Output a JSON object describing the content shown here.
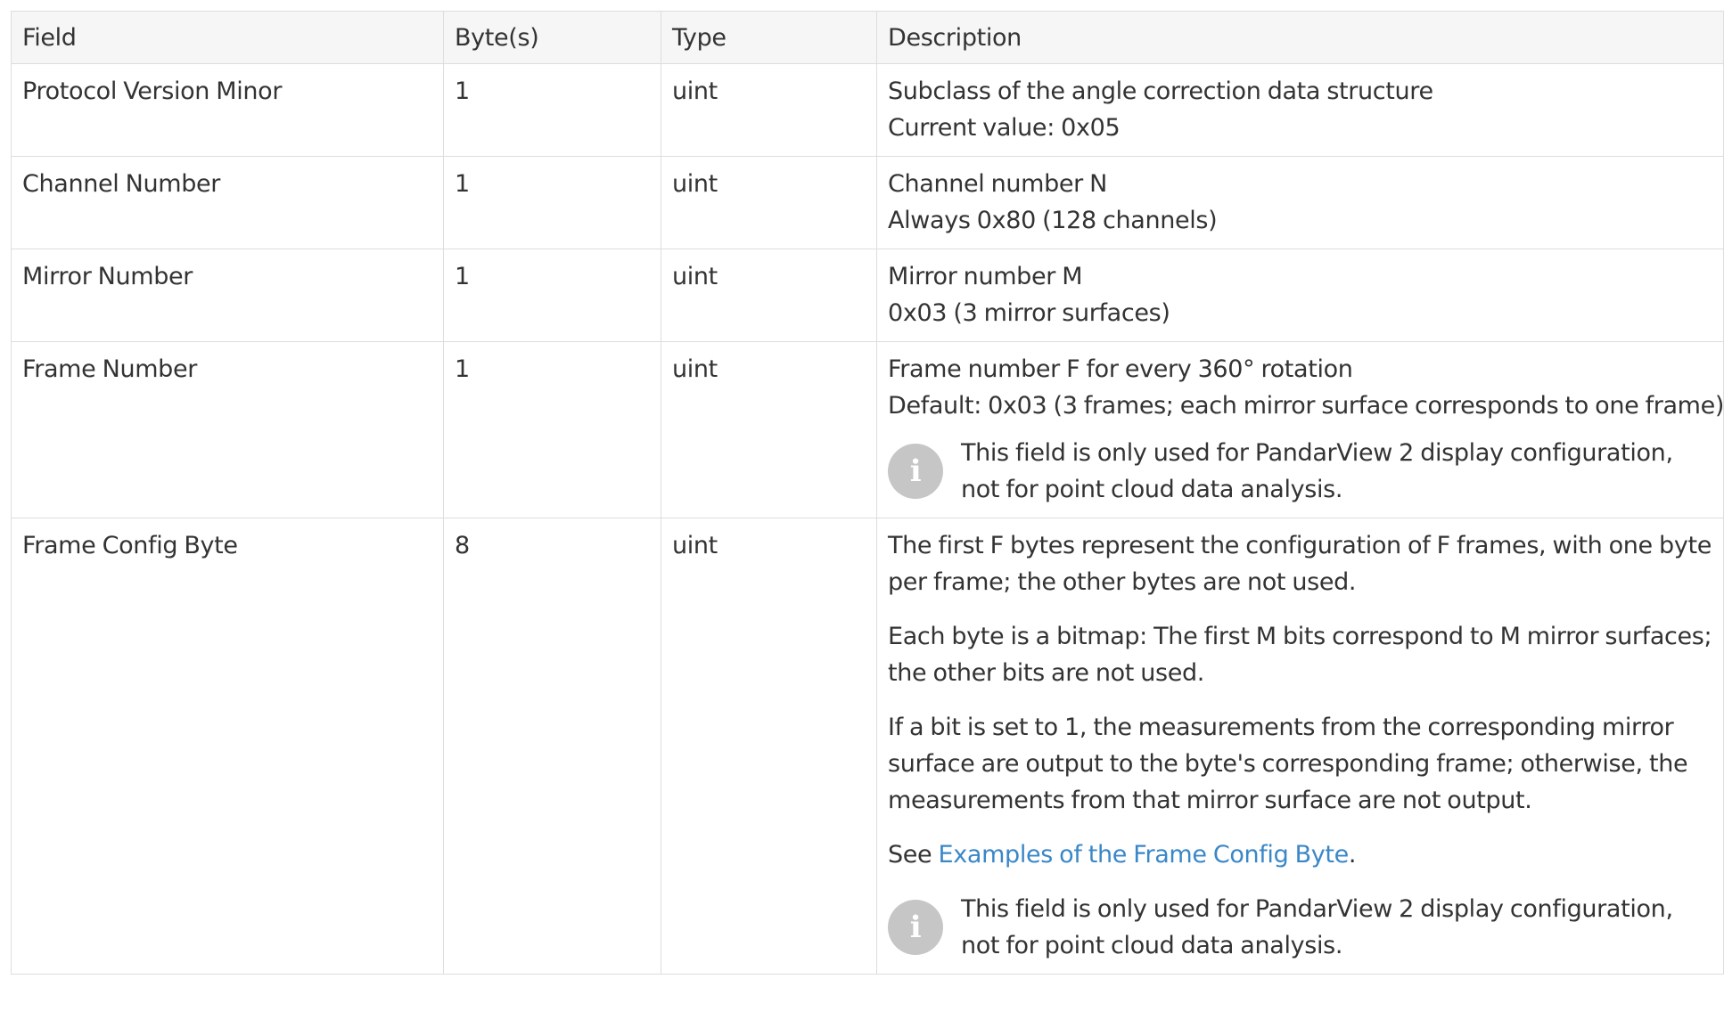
{
  "table": {
    "headers": [
      "Field",
      "Byte(s)",
      "Type",
      "Description"
    ],
    "rows": [
      {
        "field": "Protocol Version Minor",
        "bytes": "1",
        "type": "uint",
        "desc_lines": [
          "Subclass of the angle correction data structure",
          "Current value: 0x05"
        ]
      },
      {
        "field": "Channel Number",
        "bytes": "1",
        "type": "uint",
        "desc_lines": [
          "Channel number N",
          "Always 0x80 (128 channels)"
        ]
      },
      {
        "field": "Mirror Number",
        "bytes": "1",
        "type": "uint",
        "desc_lines": [
          "Mirror number M",
          "0x03 (3 mirror surfaces)"
        ]
      },
      {
        "field": "Frame Number",
        "bytes": "1",
        "type": "uint",
        "desc_lines": [
          "Frame number F for every 360° rotation",
          "Default: 0x03 (3 frames; each mirror surface corresponds to one frame)"
        ],
        "note": [
          "This field is only used for PandarView 2 display configuration,",
          "not for point cloud data analysis."
        ]
      },
      {
        "field": "Frame Config Byte",
        "bytes": "8",
        "type": "uint",
        "paragraphs": [
          [
            "The first F bytes represent the configuration of F frames, with one byte",
            "per frame; the other bytes are not used."
          ],
          [
            "Each byte is a bitmap: The first M bits correspond to M mirror surfaces;",
            "the other bits are not used."
          ],
          [
            "If a bit is set to 1, the measurements from the corresponding mirror",
            "surface are output to the byte's corresponding frame; otherwise, the",
            "measurements from that mirror surface are not output."
          ]
        ],
        "see": {
          "prefix": "See ",
          "link_text": "Examples of the Frame Config Byte",
          "suffix": "."
        },
        "note": [
          "This field is only used for PandarView 2 display configuration,",
          "not for point cloud data analysis."
        ]
      }
    ]
  },
  "icons": {
    "note": "info-icon"
  },
  "colors": {
    "link": "#3a87c8",
    "header_bg": "#f6f6f6",
    "border": "#dddddd",
    "icon_bg": "#c6c6c6"
  }
}
